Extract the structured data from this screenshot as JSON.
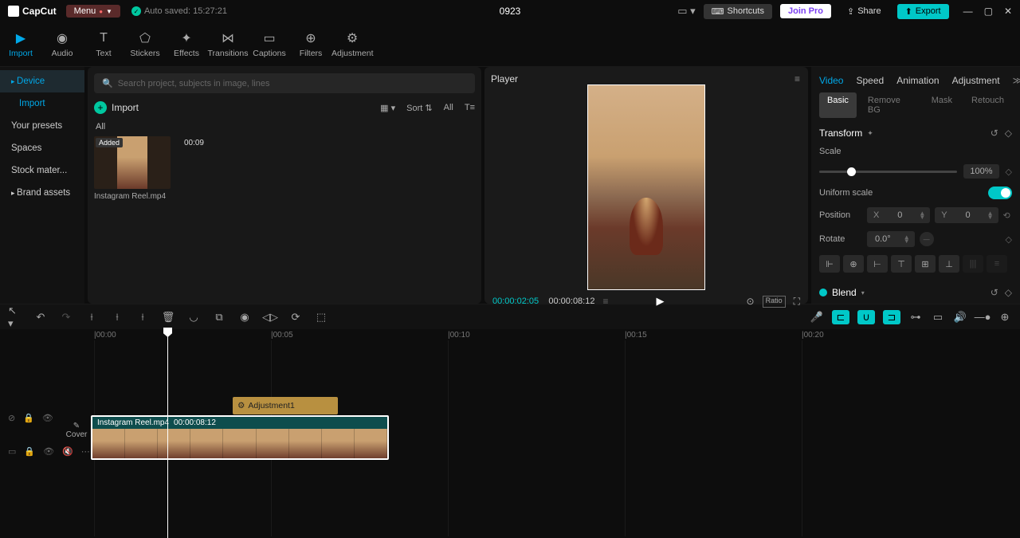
{
  "app": {
    "name": "CapCut"
  },
  "menu": "Menu",
  "autosave": "Auto saved: 15:27:21",
  "project_title": "0923",
  "top": {
    "shortcuts": "Shortcuts",
    "join": "Join Pro",
    "share": "Share",
    "export": "Export"
  },
  "tooltabs": [
    {
      "label": "Import",
      "active": true
    },
    {
      "label": "Audio",
      "active": false
    },
    {
      "label": "Text",
      "active": false
    },
    {
      "label": "Stickers",
      "active": false
    },
    {
      "label": "Effects",
      "active": false
    },
    {
      "label": "Transitions",
      "active": false
    },
    {
      "label": "Captions",
      "active": false
    },
    {
      "label": "Filters",
      "active": false
    },
    {
      "label": "Adjustment",
      "active": false
    }
  ],
  "leftbar": {
    "device": "Device",
    "import": "Import",
    "presets": "Your presets",
    "spaces": "Spaces",
    "stock": "Stock mater...",
    "brand": "Brand assets"
  },
  "media": {
    "search_placeholder": "Search project, subjects in image, lines",
    "import_btn": "Import",
    "sort": "Sort",
    "all": "All",
    "filter_all": "All",
    "thumb": {
      "badge": "Added",
      "duration": "00:09",
      "name": "Instagram Reel.mp4"
    }
  },
  "player": {
    "title": "Player",
    "time_cur": "00:00:02:05",
    "time_total": "00:00:08:12",
    "ratio_label": "Ratio"
  },
  "inspector": {
    "tabs": {
      "video": "Video",
      "speed": "Speed",
      "animation": "Animation",
      "adjustment": "Adjustment"
    },
    "subtabs": {
      "basic": "Basic",
      "removebg": "Remove BG",
      "mask": "Mask",
      "retouch": "Retouch"
    },
    "transform": "Transform",
    "scale": "Scale",
    "scale_val": "100%",
    "uniform": "Uniform scale",
    "position": "Position",
    "pos_x_label": "X",
    "pos_x": "0",
    "pos_y_label": "Y",
    "pos_y": "0",
    "rotate": "Rotate",
    "rotate_val": "0.0°",
    "blend": "Blend"
  },
  "timeline": {
    "marks": [
      "00:00",
      "00:05",
      "00:10",
      "00:15",
      "00:20"
    ],
    "adjustment_clip": "Adjustment1",
    "video_clip": {
      "name": "Instagram Reel.mp4",
      "dur": "00:00:08:12"
    },
    "cover": "Cover"
  }
}
